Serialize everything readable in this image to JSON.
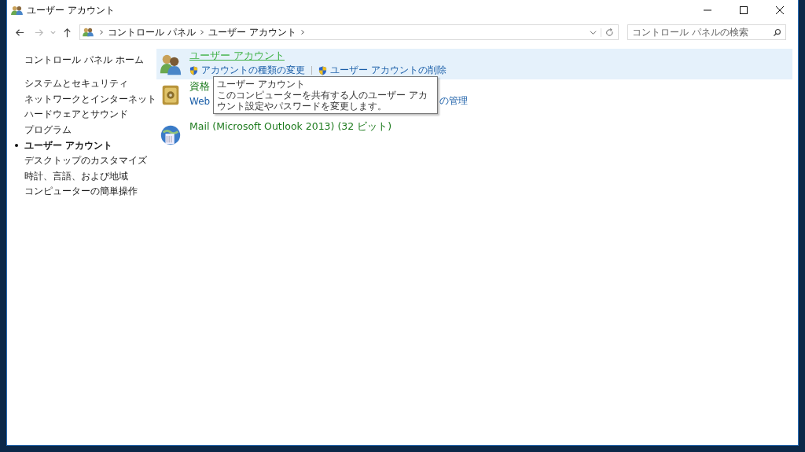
{
  "window": {
    "title": "ユーザー アカウント"
  },
  "address_bar": {
    "breadcrumbs": [
      "コントロール パネル",
      "ユーザー アカウント"
    ]
  },
  "search": {
    "placeholder": "コントロール パネルの検索"
  },
  "sidebar": {
    "home": "コントロール パネル ホーム",
    "items": [
      {
        "label": "システムとセキュリティ",
        "selected": false
      },
      {
        "label": "ネットワークとインターネット",
        "selected": false
      },
      {
        "label": "ハードウェアとサウンド",
        "selected": false
      },
      {
        "label": "プログラム",
        "selected": false
      },
      {
        "label": "ユーザー アカウント",
        "selected": true
      },
      {
        "label": "デスクトップのカスタマイズ",
        "selected": false
      },
      {
        "label": "時計、言語、および地域",
        "selected": false
      },
      {
        "label": "コンピューターの簡単操作",
        "selected": false
      }
    ]
  },
  "categories": [
    {
      "kind": "users",
      "title": "ユーザー アカウント",
      "hovered": true,
      "links": [
        {
          "text": "アカウントの種類の変更",
          "shield": true
        },
        {
          "text": "ユーザー アカウントの削除",
          "shield": true
        }
      ]
    },
    {
      "kind": "vault",
      "title": "資格",
      "hovered": false,
      "links": [
        {
          "text": "Web",
          "shield": false
        },
        {
          "text": "の管理",
          "shield": false
        }
      ]
    },
    {
      "kind": "mail",
      "title": "Mail (Microsoft Outlook 2013) (32 ビット)",
      "hovered": false
    }
  ],
  "tooltip": {
    "title": "ユーザー アカウント",
    "text": "このコンピューターを共有する人のユーザー アカウント設定やパスワードを変更します。"
  }
}
